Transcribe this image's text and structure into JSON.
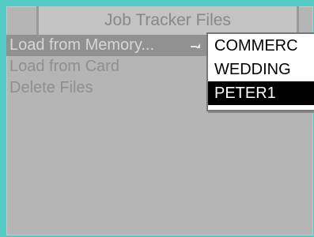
{
  "window": {
    "title": "Job Tracker Files"
  },
  "menu": {
    "items": [
      {
        "label": "Load from Memory...",
        "selected": true,
        "has_submenu": true
      },
      {
        "label": "Load from Card",
        "selected": false
      },
      {
        "label": "Delete Files",
        "selected": false
      }
    ]
  },
  "popup": {
    "items": [
      {
        "label": "COMMERC",
        "highlighted": false
      },
      {
        "label": "WEDDING",
        "highlighted": false
      },
      {
        "label": "PETER1",
        "highlighted": true
      }
    ]
  },
  "colors": {
    "outer_background": "#55cbc4",
    "screen_background": "#b5b5b5",
    "selection": "#919191",
    "popup_highlight": "#000000"
  }
}
